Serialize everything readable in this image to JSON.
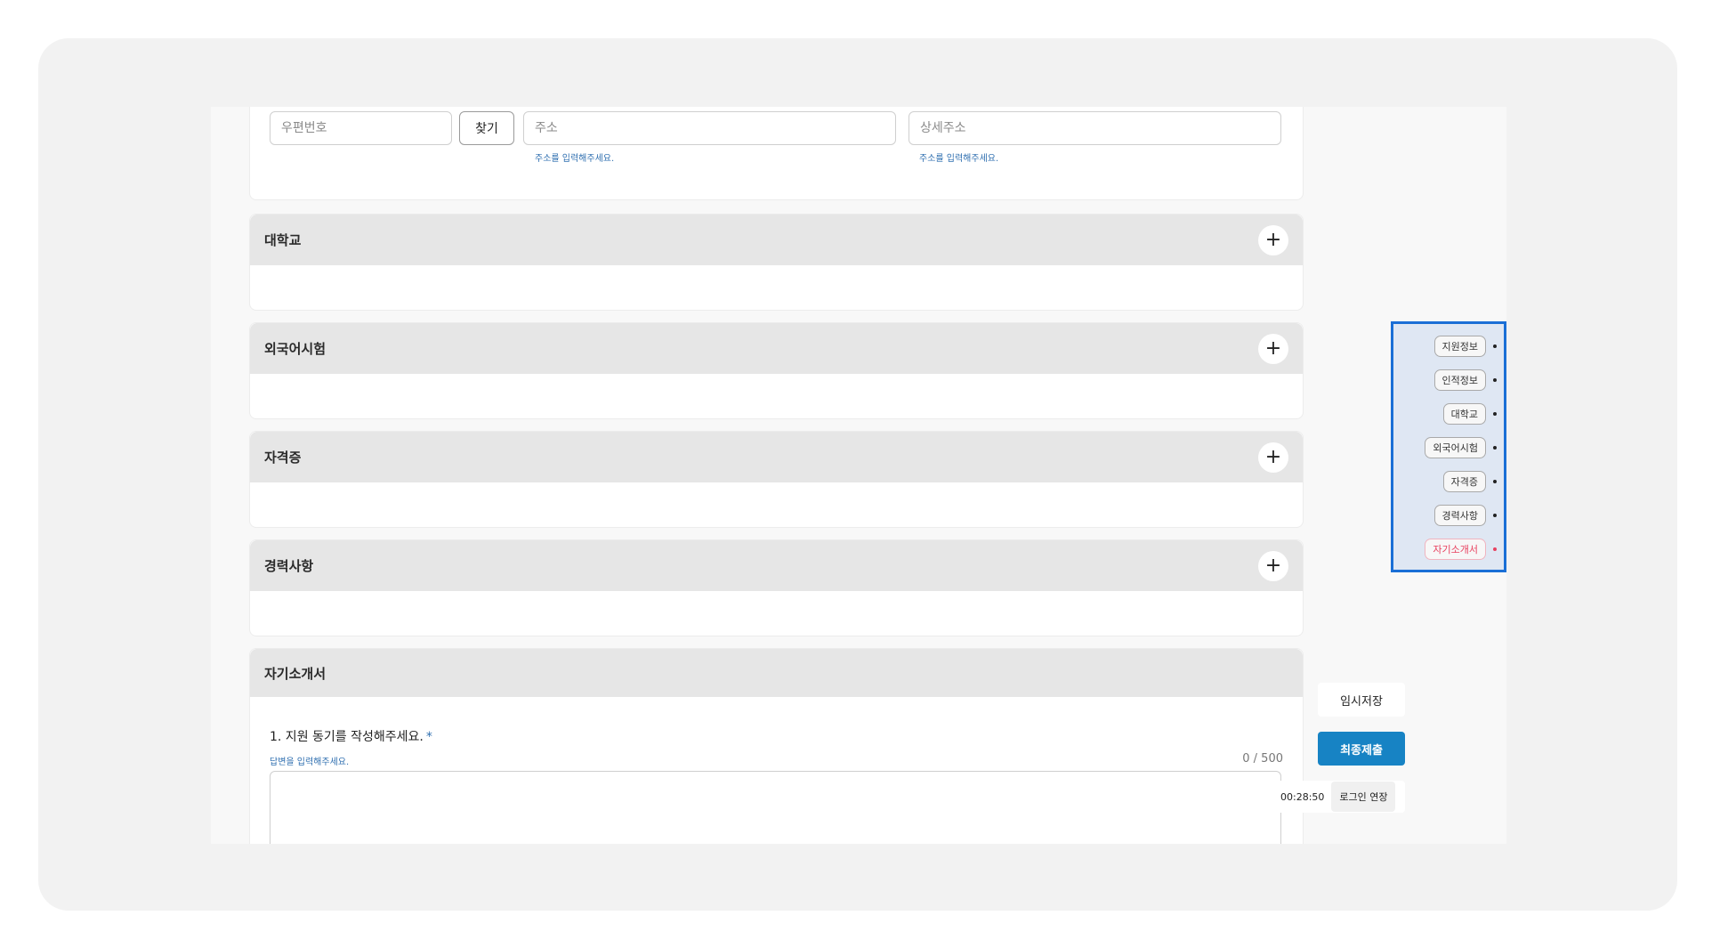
{
  "address": {
    "postcode_placeholder": "우편번호",
    "find_label": "찾기",
    "address_placeholder": "주소",
    "address_hint": "주소를 입력해주세요.",
    "detail_placeholder": "상세주소",
    "detail_hint": "주소를 입력해주세요."
  },
  "sections": [
    {
      "title": "대학교",
      "action_icon": "plus-icon"
    },
    {
      "title": "외국어시험",
      "action_icon": "plus-icon"
    },
    {
      "title": "자격증",
      "action_icon": "plus-icon"
    },
    {
      "title": "경력사항",
      "action_icon": "plus-icon"
    }
  ],
  "essay": {
    "title": "자기소개서",
    "question": "1. 지원 동기를 작성해주세요.",
    "required_mark": "*",
    "hint": "답변을 입력해주세요.",
    "counter": "0 / 500"
  },
  "side_nav": {
    "items": [
      {
        "label": "지원정보",
        "active": false
      },
      {
        "label": "인적정보",
        "active": false
      },
      {
        "label": "대학교",
        "active": false
      },
      {
        "label": "외국어시험",
        "active": false
      },
      {
        "label": "자격증",
        "active": false
      },
      {
        "label": "경력사항",
        "active": false
      },
      {
        "label": "자기소개서",
        "active": true
      }
    ],
    "active_color": "#e8415f",
    "highlight_color": "#1a6fd6"
  },
  "actions": {
    "temp_save_label": "임시저장",
    "submit_label": "최종제출",
    "submit_color": "#1783c4"
  },
  "session": {
    "timer": "00:28:50",
    "extend_label": "로그인 연장"
  }
}
